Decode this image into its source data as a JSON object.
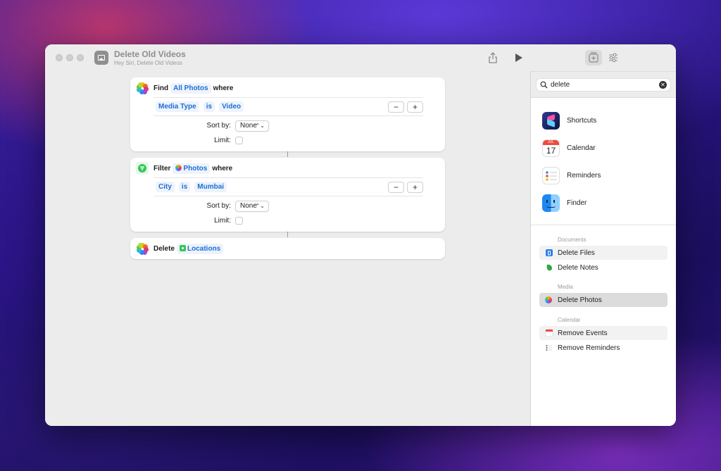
{
  "window": {
    "title": "Delete Old Videos",
    "subtitle": "Hey Siri, Delete Old Videos"
  },
  "actions": [
    {
      "verb": "Find",
      "target": "All Photos",
      "suffix": "where",
      "condition": {
        "field": "Media Type",
        "op": "is",
        "value": "Video"
      },
      "sort_label": "Sort by:",
      "sort_value": "None",
      "limit_label": "Limit:"
    },
    {
      "verb": "Filter",
      "target": "Photos",
      "suffix": "where",
      "condition": {
        "field": "City",
        "op": "is",
        "value": "Mumbai"
      },
      "sort_label": "Sort by:",
      "sort_value": "None",
      "limit_label": "Limit:"
    },
    {
      "verb": "Delete",
      "target": "Locations"
    }
  ],
  "stepper": {
    "minus": "−",
    "plus": "+"
  },
  "search": {
    "value": "delete"
  },
  "apps": [
    {
      "name": "Shortcuts"
    },
    {
      "name": "Calendar",
      "month": "JUL",
      "day": "17"
    },
    {
      "name": "Reminders"
    },
    {
      "name": "Finder"
    }
  ],
  "sections": [
    {
      "header": "Documents",
      "items": [
        "Delete Files",
        "Delete Notes"
      ]
    },
    {
      "header": "Media",
      "items": [
        "Delete Photos"
      ]
    },
    {
      "header": "Calendar",
      "items": [
        "Remove Events",
        "Remove Reminders"
      ]
    }
  ],
  "colors": {
    "accent": "#1b6fd6",
    "selected_row": "#dcdcdc",
    "hover_row": "#f2f2f2"
  }
}
